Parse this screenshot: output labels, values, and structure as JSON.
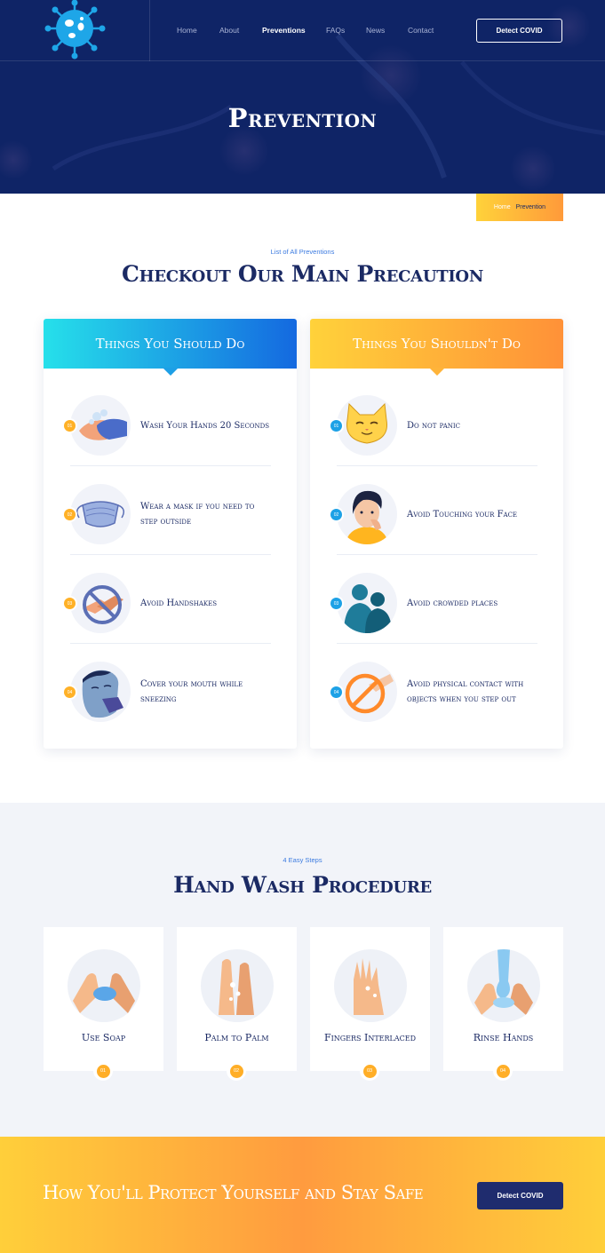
{
  "header": {
    "nav": [
      {
        "label": "Home",
        "active": false
      },
      {
        "label": "About",
        "active": false
      },
      {
        "label": "Preventions",
        "active": true
      },
      {
        "label": "FAQs",
        "active": false
      },
      {
        "label": "News",
        "active": false
      },
      {
        "label": "Contact",
        "active": false
      }
    ],
    "cta_label": "Detect COVID"
  },
  "hero": {
    "title": "Prevention"
  },
  "breadcrumb": {
    "home": "Home",
    "current": "Prevention"
  },
  "precautions": {
    "eyebrow": "List of All Preventions",
    "title": "Checkout Our Main Precaution",
    "do": {
      "heading": "Things You Should Do",
      "items": [
        {
          "num": "01",
          "label": "Wash Your Hands 20 Seconds",
          "icon": "hand-washing-icon"
        },
        {
          "num": "02",
          "label": "Wear a mask if you need to step outside",
          "icon": "face-mask-icon"
        },
        {
          "num": "03",
          "label": "Avoid Handshakes",
          "icon": "no-handshake-icon"
        },
        {
          "num": "04",
          "label": "Cover your mouth while sneezing",
          "icon": "sneezing-person-icon"
        }
      ]
    },
    "dont": {
      "heading": "Things You Shouldn't Do",
      "items": [
        {
          "num": "01",
          "label": "Do not panic",
          "icon": "calm-cat-icon"
        },
        {
          "num": "02",
          "label": "Avoid Touching your Face",
          "icon": "touching-face-icon"
        },
        {
          "num": "03",
          "label": "Avoid crowded places",
          "icon": "crowd-icon"
        },
        {
          "num": "04",
          "label": "Avoid physical contact with objects when you step out",
          "icon": "no-touch-icon"
        }
      ]
    }
  },
  "handwash": {
    "eyebrow": "4 Easy Steps",
    "title": "Hand Wash Procedure",
    "steps": [
      {
        "num": "01",
        "label": "Use Soap",
        "icon": "soap-hands-icon"
      },
      {
        "num": "02",
        "label": "Palm to Palm",
        "icon": "palm-to-palm-icon"
      },
      {
        "num": "03",
        "label": "Fingers Interlaced",
        "icon": "fingers-interlaced-icon"
      },
      {
        "num": "04",
        "label": "Rinse Hands",
        "icon": "rinse-hands-icon"
      }
    ]
  },
  "cta": {
    "title": "How You'll Protect Yourself and Stay Safe",
    "button": "Detect COVID"
  },
  "colors": {
    "navy": "#0f2466",
    "accent_blue": "#1469e0",
    "accent_orange": "#ff9138",
    "accent_yellow": "#ffd23a"
  }
}
